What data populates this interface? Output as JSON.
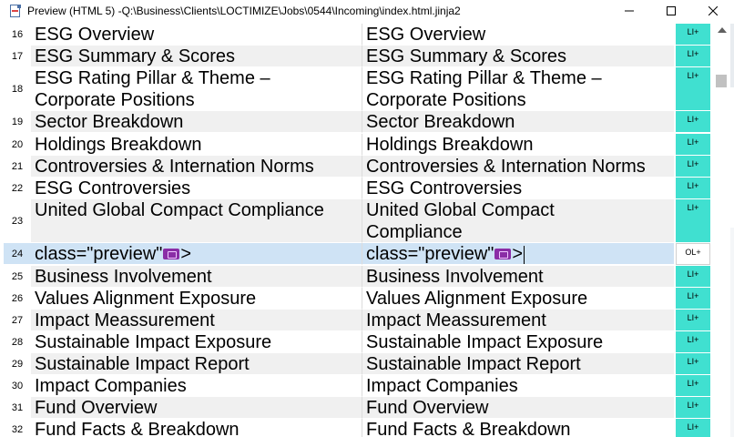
{
  "window": {
    "title": "Preview (HTML 5) -Q:\\Business\\Clients\\LOCTIMIZE\\Jobs\\0544\\Incoming\\index.html.jinja2",
    "controls": [
      "minimize-icon",
      "maximize-icon",
      "close-icon"
    ]
  },
  "rows": [
    {
      "num": "16",
      "source": "ESG Overview",
      "target": "ESG Overview",
      "status": "LI+"
    },
    {
      "num": "17",
      "source": "ESG Summary & Scores",
      "target": "ESG Summary & Scores",
      "status": "LI+"
    },
    {
      "num": "18",
      "source": "ESG Rating Pillar & Theme –\nCorporate Positions",
      "target": "ESG Rating Pillar & Theme –\nCorporate Positions",
      "status": "LI+"
    },
    {
      "num": "19",
      "source": "Sector Breakdown",
      "target": "Sector Breakdown",
      "status": "LI+"
    },
    {
      "num": "20",
      "source": "Holdings Breakdown",
      "target": "Holdings Breakdown",
      "status": "LI+"
    },
    {
      "num": "21",
      "source": "Controversies & Internation Norms",
      "target": "Controversies & Internation Norms",
      "status": "LI+"
    },
    {
      "num": "22",
      "source": "ESG Controversies",
      "target": "ESG Controversies",
      "status": "LI+"
    },
    {
      "num": "23",
      "source": "United Global Compact Compliance",
      "target": "United Global Compact\nCompliance",
      "status": "LI+"
    },
    {
      "num": "24",
      "source_before": "class=\"preview\"",
      "source_after": ">",
      "target_before": "class=\"preview\"",
      "target_after": ">",
      "status": "OL+"
    },
    {
      "num": "25",
      "source": "Business Involvement",
      "target": "Business Involvement",
      "status": "LI+"
    },
    {
      "num": "26",
      "source": "Values Alignment Exposure",
      "target": "Values Alignment Exposure",
      "status": "LI+"
    },
    {
      "num": "27",
      "source": "Impact Meassurement",
      "target": "Impact Meassurement",
      "status": "LI+"
    },
    {
      "num": "28",
      "source": "Sustainable Impact Exposure",
      "target": "Sustainable Impact Exposure",
      "status": "LI+"
    },
    {
      "num": "29",
      "source": "Sustainable Impact Report",
      "target": "Sustainable Impact Report",
      "status": "LI+"
    },
    {
      "num": "30",
      "source": "Impact Companies",
      "target": "Impact Companies",
      "status": "LI+"
    },
    {
      "num": "31",
      "source": "Fund Overview",
      "target": "Fund Overview",
      "status": "LI+"
    },
    {
      "num": "32",
      "source": "Fund Facts & Breakdown",
      "target": "Fund Facts & Breakdown",
      "status": "LI+"
    }
  ],
  "colors": {
    "status_li": "#40e0d0",
    "current_row": "#cfe3f5",
    "alt_row": "#f0f0f0",
    "tag": "#8a2da6"
  }
}
